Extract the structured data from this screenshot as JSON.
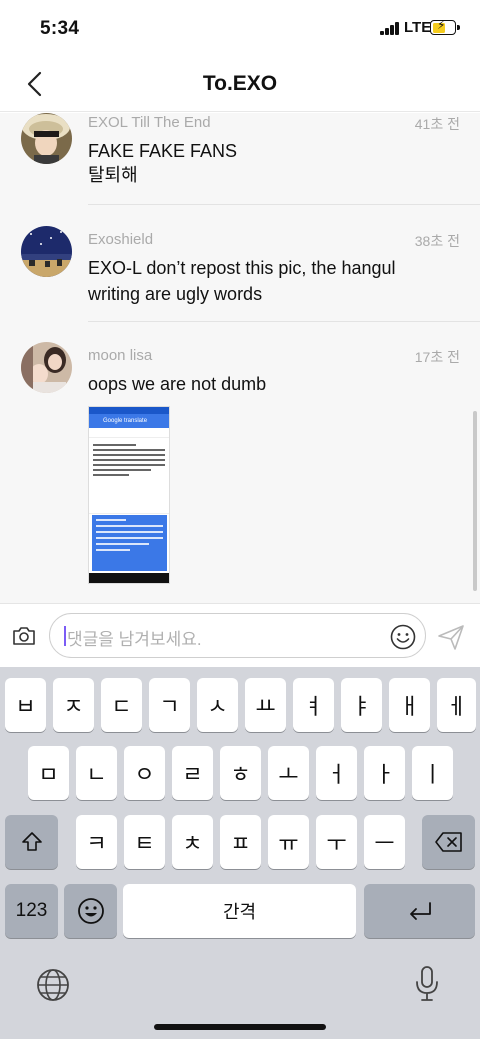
{
  "status_bar": {
    "time": "5:34",
    "network": "LTE"
  },
  "header": {
    "title": "To.EXO"
  },
  "comments": [
    {
      "name": "EXOL Till The End",
      "time": "41초 전",
      "lines": [
        "FAKE FAKE FANS",
        "탈퇴해"
      ]
    },
    {
      "name": "Exoshield",
      "time": "38초 전",
      "lines": [
        "EXO-L don’t repost this pic, the hangul",
        "writing are ugly words"
      ]
    },
    {
      "name": "moon lisa",
      "time": "17초 전",
      "lines": [
        "oops we are not dumb"
      ]
    }
  ],
  "attachment": {
    "app_bar_text": "Google translate"
  },
  "composer": {
    "placeholder": "댓글을 남겨보세요."
  },
  "keyboard": {
    "row1": [
      "ㅂ",
      "ㅈ",
      "ㄷ",
      "ㄱ",
      "ㅅ",
      "ㅛ",
      "ㅕ",
      "ㅑ",
      "ㅐ",
      "ㅔ"
    ],
    "row2": [
      "ㅁ",
      "ㄴ",
      "ㅇ",
      "ㄹ",
      "ㅎ",
      "ㅗ",
      "ㅓ",
      "ㅏ",
      "ㅣ"
    ],
    "row3": [
      "ㅋ",
      "ㅌ",
      "ㅊ",
      "ㅍ",
      "ㅠ",
      "ㅜ",
      "ㅡ"
    ],
    "numbers_label": "123",
    "space_label": "간격"
  },
  "colors": {
    "accent_caret": "#7b5cf5",
    "battery": "#f5cc1e",
    "keyboard_bg": "#d3d5db"
  }
}
